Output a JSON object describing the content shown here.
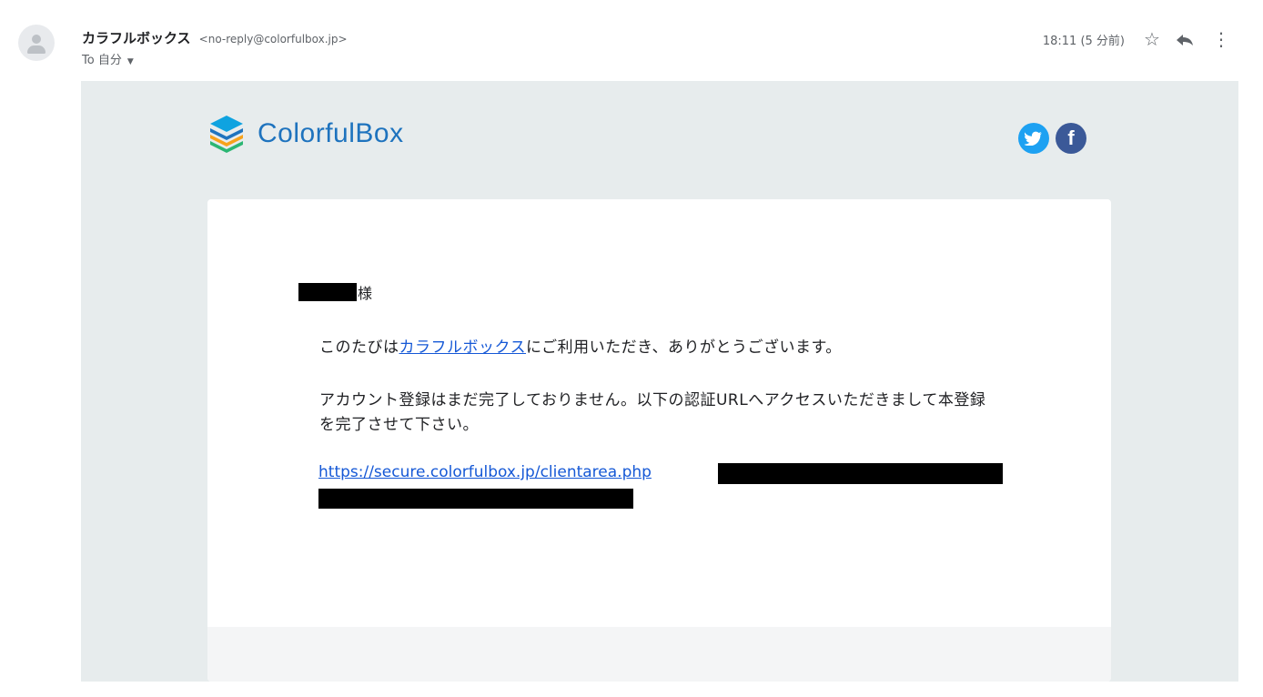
{
  "sender": {
    "name": "カラフルボックス",
    "email": "<no-reply@colorfulbox.jp>",
    "recipient": "To 自分",
    "timestamp": "18:11 (5 分前)"
  },
  "icons": {
    "avatar": "person-icon",
    "star": "star-outline-icon",
    "reply": "reply-icon",
    "more": "more-vert-icon",
    "dropdown": "chevron-down-icon",
    "twitter": "twitter-icon",
    "facebook": "facebook-icon"
  },
  "email": {
    "brand": "ColorfulBox",
    "greeting_suffix": "様",
    "line1_prefix": "このたびは",
    "line1_link": "カラフルボックス",
    "line1_suffix": "にご利用いただき、ありがとうございます。",
    "line2": "アカウント登録はまだ完了しておりません。以下の認証URLへアクセスいただきまして本登録を完了させて下さい。",
    "url": "https://secure.colorfulbox.jp/clientarea.php"
  },
  "colors": {
    "brand_blue": "#1e73be",
    "link": "#1558d6",
    "twitter": "#1da1f2",
    "facebook": "#3b5998",
    "email_bg": "#e7eced"
  }
}
